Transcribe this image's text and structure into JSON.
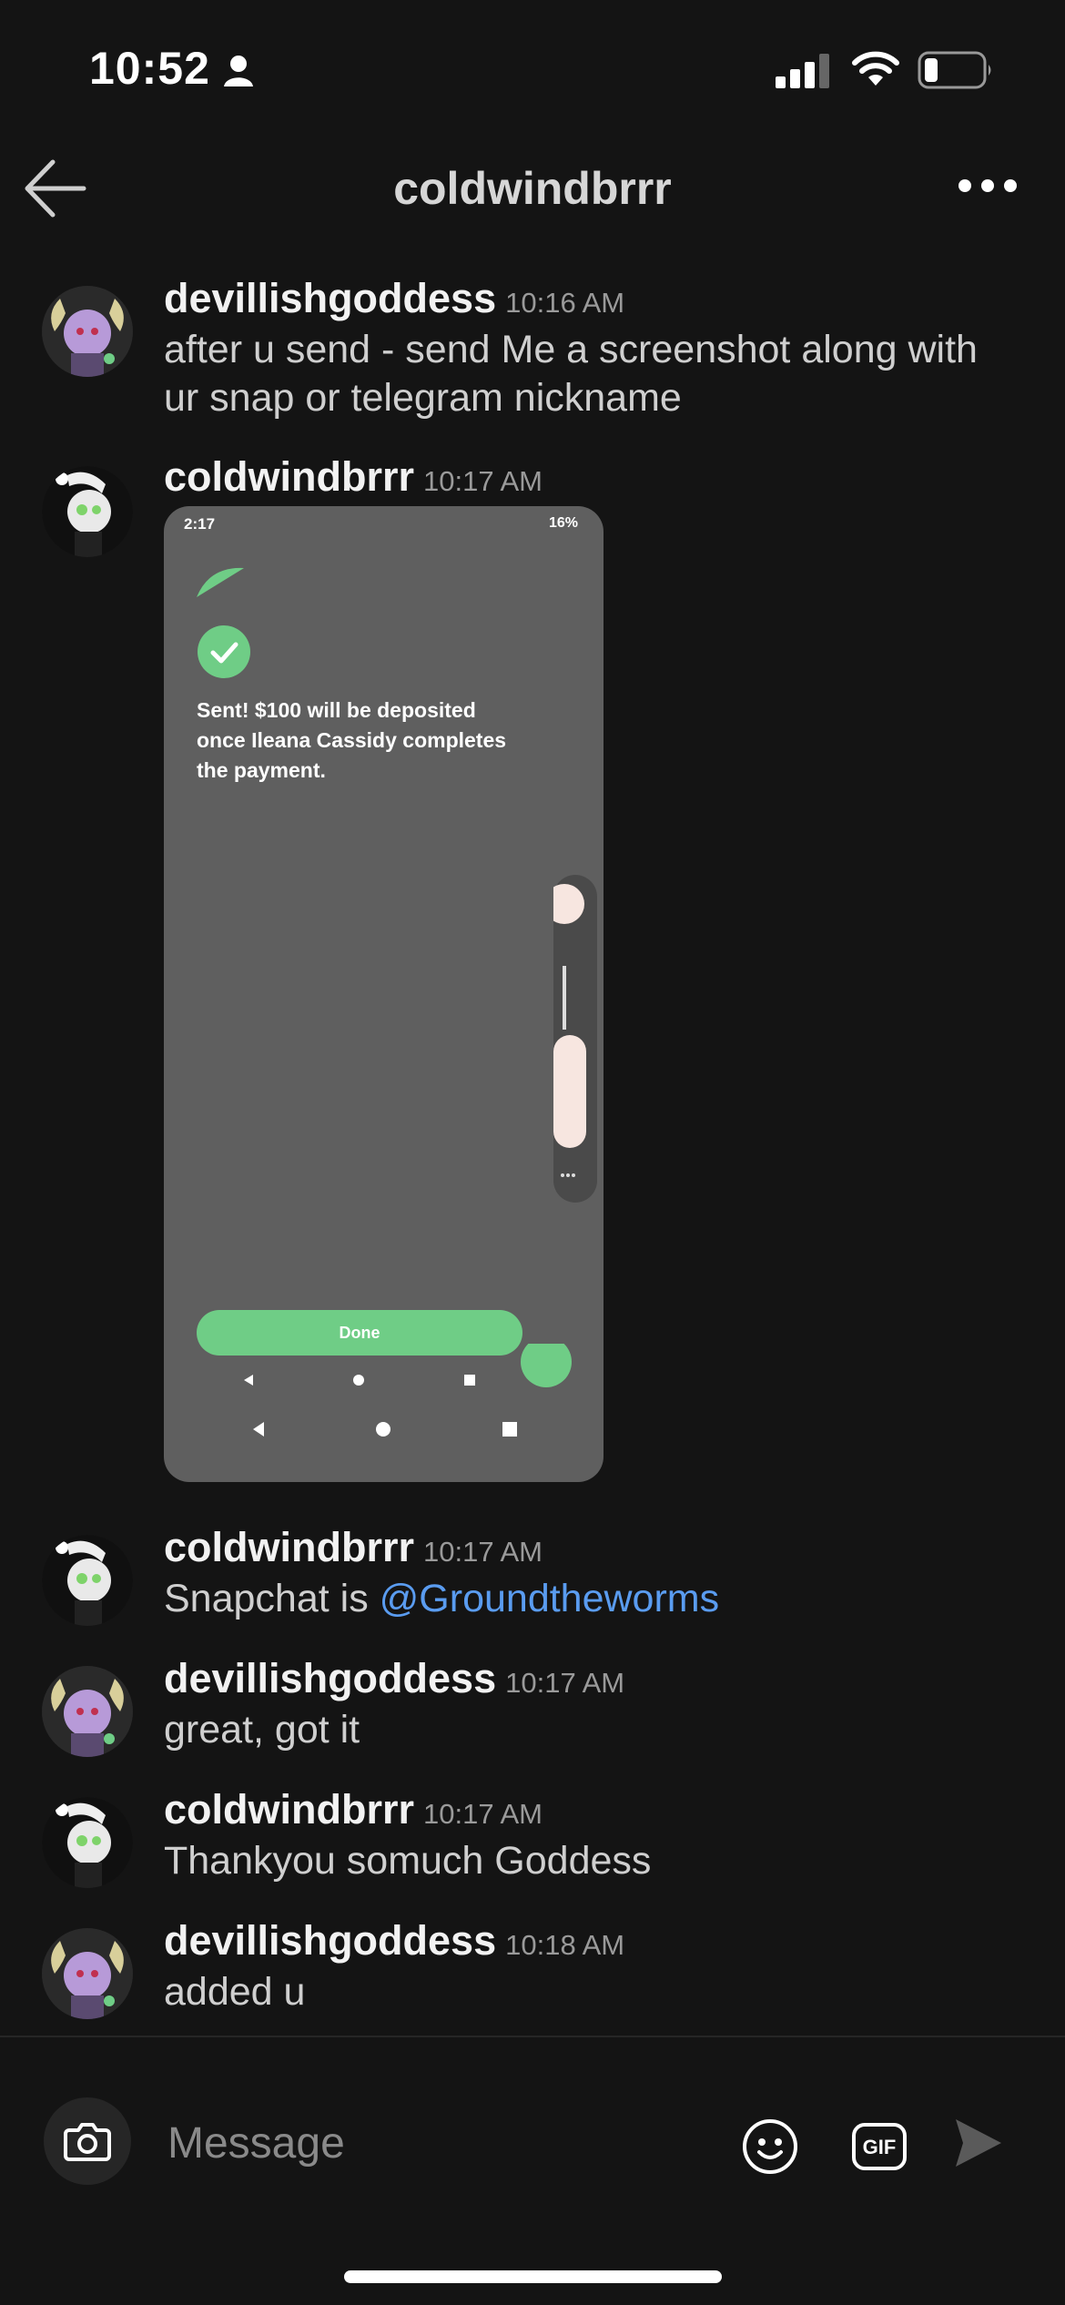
{
  "status_bar": {
    "time": "10:52"
  },
  "header": {
    "title": "coldwindbrrr"
  },
  "messages": [
    {
      "author": "devillishgoddess",
      "time": "10:16 AM",
      "text": "after u send - send Me a screenshot along with ur snap or telegram nickname"
    },
    {
      "author": "coldwindbrrr",
      "time": "10:17 AM",
      "attachment": {
        "status_time": "2:17",
        "status_battery": "16%",
        "text": "Sent! $100 will be deposited once Ileana Cassidy completes the payment.",
        "button": "Done"
      }
    },
    {
      "author": "coldwindbrrr",
      "time": "10:17 AM",
      "text_prefix": "Snapchat is ",
      "mention": "@Groundtheworms"
    },
    {
      "author": "devillishgoddess",
      "time": "10:17 AM",
      "text": "great, got it"
    },
    {
      "author": "coldwindbrrr",
      "time": "10:17 AM",
      "text": "Thankyou somuch Goddess"
    },
    {
      "author": "devillishgoddess",
      "time": "10:18 AM",
      "text": "added u"
    }
  ],
  "composer": {
    "placeholder": "Message",
    "gif_label": "GIF"
  },
  "colors": {
    "background": "#141414",
    "mention": "#5a9cf0",
    "success": "#6fcd86"
  }
}
